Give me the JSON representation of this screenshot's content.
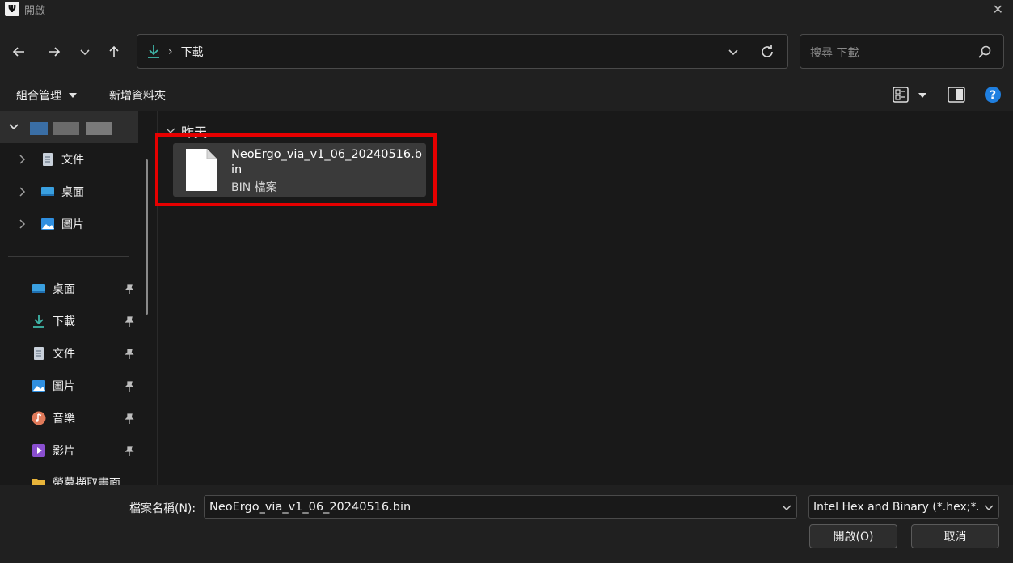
{
  "window": {
    "title": "開啟",
    "app_icon_glyph": "Ψ",
    "close_glyph": "✕"
  },
  "nav": {
    "back_icon": "back-arrow-icon",
    "forward_icon": "forward-arrow-icon",
    "recent_icon": "chevron-down-icon",
    "up_icon": "up-arrow-icon",
    "address": {
      "location": "下載",
      "separator": "›"
    },
    "search": {
      "placeholder": "搜尋 下載"
    }
  },
  "toolbar": {
    "organize_label": "組合管理",
    "new_folder_label": "新增資料夾"
  },
  "sidebar": {
    "tree_items": [
      {
        "label": "文件",
        "icon": "document-icon"
      },
      {
        "label": "桌面",
        "icon": "desktop-icon"
      },
      {
        "label": "圖片",
        "icon": "pictures-icon"
      }
    ],
    "quick_access": [
      {
        "label": "桌面",
        "icon": "desktop-icon"
      },
      {
        "label": "下載",
        "icon": "download-icon"
      },
      {
        "label": "文件",
        "icon": "document-icon"
      },
      {
        "label": "圖片",
        "icon": "pictures-icon"
      },
      {
        "label": "音樂",
        "icon": "music-icon"
      },
      {
        "label": "影片",
        "icon": "video-icon"
      },
      {
        "label": "螢幕擷取畫面",
        "icon": "folder-icon"
      }
    ]
  },
  "main": {
    "group_label": "昨天",
    "files": [
      {
        "name": "NeoErgo_via_v1_06_20240516.bin",
        "type": "BIN 檔案"
      }
    ]
  },
  "footer": {
    "filename_label": "檔案名稱(N):",
    "filename_value": "NeoErgo_via_v1_06_20240516.bin",
    "filetype_value": "Intel Hex and Binary (*.hex;*.bin)",
    "open_button": "開啟(O)",
    "cancel_button": "取消"
  },
  "colors": {
    "accent": "#3fb6a8",
    "highlight": "#e60000",
    "help": "#1f7fe0"
  }
}
